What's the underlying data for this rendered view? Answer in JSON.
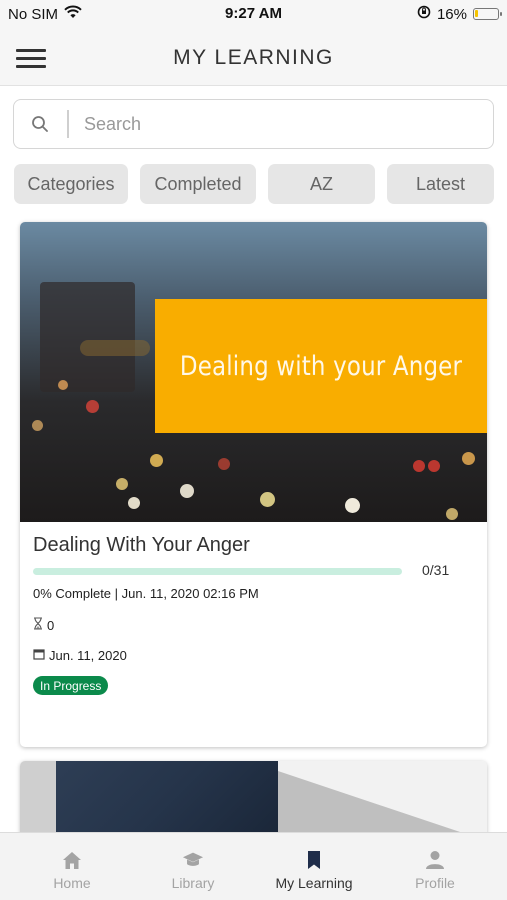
{
  "status_bar": {
    "carrier": "No SIM",
    "time": "9:27 AM",
    "battery_percent": "16%",
    "battery_level": 0.16,
    "icons": [
      "wifi-icon",
      "rotation-lock-icon",
      "battery-icon"
    ]
  },
  "header": {
    "title": "MY LEARNING",
    "menu_icon": "hamburger-menu-icon"
  },
  "search": {
    "placeholder": "Search",
    "value": "",
    "icon": "search-icon"
  },
  "filters": [
    {
      "label": "Categories"
    },
    {
      "label": "Completed"
    },
    {
      "label": "AZ"
    },
    {
      "label": "Latest"
    }
  ],
  "courses": [
    {
      "banner_text": "Dealing with your Anger",
      "title": "Dealing With Your Anger",
      "progress_fraction": 0.0,
      "progress_count": "0/31",
      "complete_text": "0% Complete | Jun. 11, 2020 02:16 PM",
      "duration_value": "0",
      "date": "Jun. 11, 2020",
      "status": "In Progress",
      "colors": {
        "banner": "#f9ad00",
        "status_badge": "#0b8a4b",
        "progress": "#8fd9bd"
      }
    }
  ],
  "bottom_nav": [
    {
      "label": "Home",
      "icon": "home-icon",
      "active": false
    },
    {
      "label": "Library",
      "icon": "graduation-cap-icon",
      "active": false
    },
    {
      "label": "My Learning",
      "icon": "bookmark-icon",
      "active": true
    },
    {
      "label": "Profile",
      "icon": "person-icon",
      "active": false
    }
  ],
  "colors": {
    "active_nav": "#1f2d4a",
    "inactive_nav": "#a3a3a3"
  }
}
